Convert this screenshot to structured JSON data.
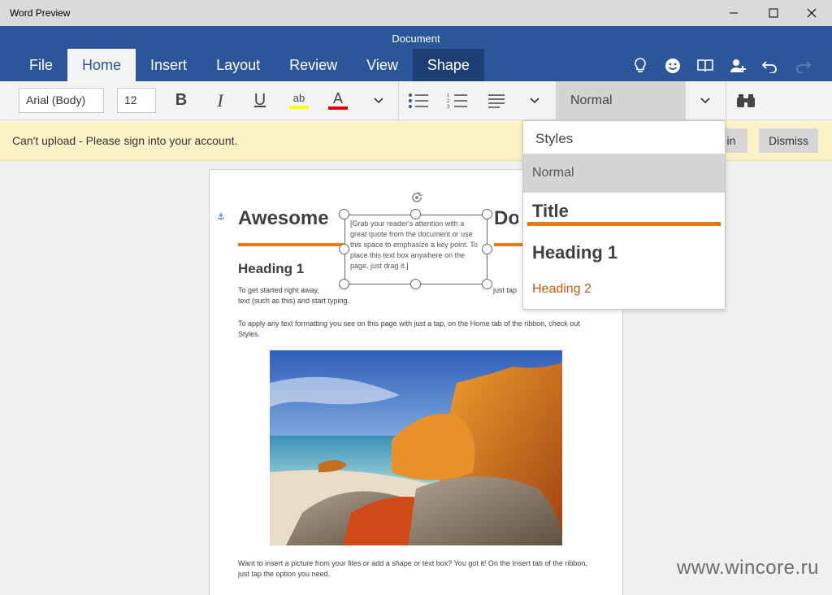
{
  "window": {
    "app_title": "Word Preview"
  },
  "ribbon": {
    "doc_title": "Document",
    "tabs": [
      {
        "label": "File"
      },
      {
        "label": "Home"
      },
      {
        "label": "Insert"
      },
      {
        "label": "Layout"
      },
      {
        "label": "Review"
      },
      {
        "label": "View"
      },
      {
        "label": "Shape"
      }
    ],
    "active_tab": "Home",
    "icons": [
      "lightbulb-icon",
      "smiley-icon",
      "book-icon",
      "add-person-icon",
      "undo-icon",
      "redo-icon"
    ]
  },
  "toolbar": {
    "font_name": "Arial (Body)",
    "font_size": "12",
    "bold": "B",
    "italic": "I",
    "underline": "U",
    "highlight": "ab",
    "font_color": "A",
    "current_style": "Normal"
  },
  "notification": {
    "message": "Can't upload - Please sign into your account.",
    "sign_in_label": "in",
    "dismiss_label": "Dismiss"
  },
  "document": {
    "title_left": "Awesome",
    "title_right": "Doc",
    "quote": "[Grab your reader's attention with a great quote from the document or use this space to emphasize a key point. To place this text box anywhere on the page, just drag it.]",
    "heading": "Heading 1",
    "para1_left": "To get started right away,",
    "para1_right": "just tap",
    "para1_line2": "text (such as this) and start typing.",
    "para2": "To apply any text formatting you see on this page with just a tap, on the Home tab of the ribbon, check out Styles.",
    "para3": "Want to insert a picture from your files or add a shape or text box? You got it! On the Insert tab of the ribbon, just tap the option you need."
  },
  "styles_pane": {
    "header": "Styles",
    "items": [
      {
        "label": "Normal"
      },
      {
        "label": "Title"
      },
      {
        "label": "Heading 1"
      },
      {
        "label": "Heading 2"
      }
    ]
  },
  "watermark": "www.wincore.ru",
  "colors": {
    "ribbon_blue": "#2b579a",
    "shape_tab": "#1e3f73",
    "accent_orange": "#e97a12",
    "heading2_orange": "#c55a11",
    "notification_bg": "#fdf2c7"
  }
}
